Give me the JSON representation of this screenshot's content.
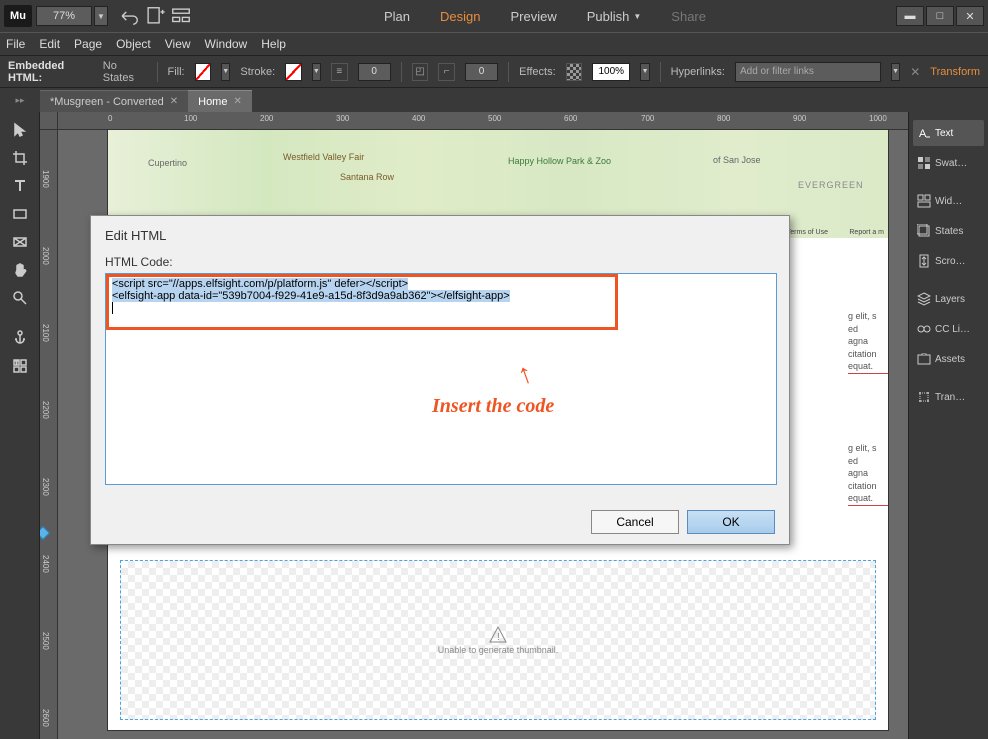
{
  "app": {
    "logo": "Mu",
    "zoom": "77%"
  },
  "topTabs": {
    "plan": "Plan",
    "design": "Design",
    "preview": "Preview",
    "publish": "Publish",
    "share": "Share"
  },
  "menu": {
    "file": "File",
    "edit": "Edit",
    "page": "Page",
    "object": "Object",
    "view": "View",
    "window": "Window",
    "help": "Help"
  },
  "control": {
    "objectType": "Embedded HTML:",
    "states": "No States",
    "fill": "Fill:",
    "stroke": "Stroke:",
    "strokeVal": "0",
    "cornerVal": "0",
    "effects": "Effects:",
    "opacity": "100%",
    "hyperlinks": "Hyperlinks:",
    "hyperlinkPlaceholder": "Add or filter links",
    "transform": "Transform"
  },
  "docTabs": {
    "tab1": "*Musgreen - Converted",
    "tab2": "Home"
  },
  "rulerH": [
    "0",
    "100",
    "200",
    "300",
    "400",
    "500",
    "600",
    "700",
    "800",
    "900",
    "1000"
  ],
  "rulerV": [
    "1900",
    "2000",
    "2100",
    "2200",
    "2300",
    "2400",
    "2500",
    "2600"
  ],
  "map": {
    "cupertino": "Cupertino",
    "westfield": "Westfield Valley Fair",
    "santana": "Santana Row",
    "happy": "Happy Hollow Park & Zoo",
    "sanjose": "of San Jose",
    "evergreen": "EVERGREEN",
    "terms": "Terms of Use",
    "report": "Report a m"
  },
  "textSnips": {
    "elit": "g elit, s ed",
    "agna": "agna",
    "citation": "citation",
    "equat": "equat."
  },
  "placeholder": {
    "msg": "Unable to generate thumbnail."
  },
  "dialog": {
    "title": "Edit HTML",
    "label": "HTML Code:",
    "line1": "<script src=\"//apps.elfsight.com/p/platform.js\" defer></script>",
    "line2": "<elfsight-app data-id=\"539b7004-f929-41e9-a15d-8f3d9a9ab362\"></elfsight-app>",
    "cancel": "Cancel",
    "ok": "OK"
  },
  "annotation": {
    "text": "Insert the code"
  },
  "panels": {
    "text": "Text",
    "swatches": "Swat…",
    "widgets": "Wid…",
    "states": "States",
    "scroll": "Scro…",
    "layers": "Layers",
    "cclib": "CC Li…",
    "assets": "Assets",
    "transform": "Tran…"
  }
}
